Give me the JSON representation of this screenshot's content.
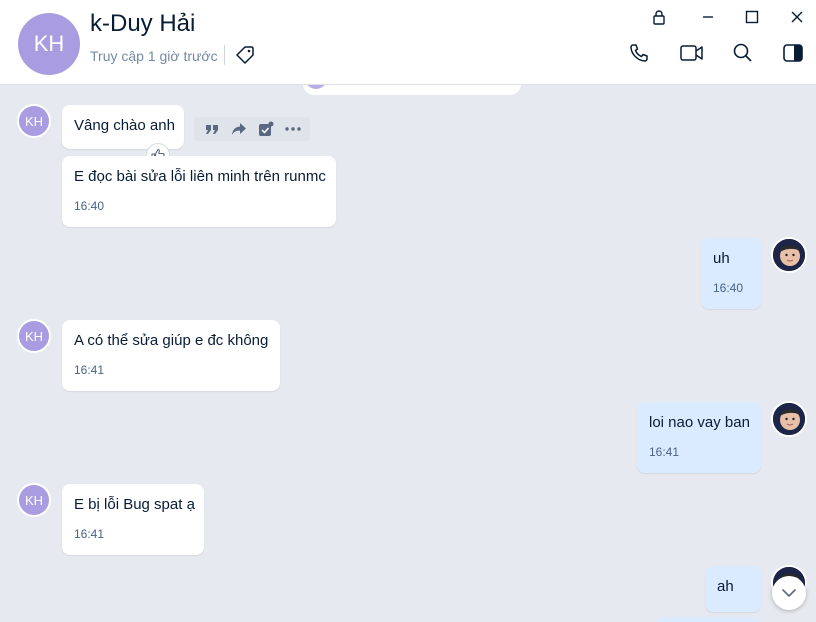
{
  "header": {
    "avatar_initials": "KH",
    "contact_name": "k-Duy Hải",
    "last_seen": "Truy cập 1 giờ trước"
  },
  "colors": {
    "avatar": "#a99ce0",
    "my_bubble": "#dbebff",
    "their_bubble": "#ffffff",
    "chat_bg": "#e6e9ef"
  },
  "icons": [
    "lock-icon",
    "minimize-icon",
    "maximize-icon",
    "close-icon",
    "tag-icon",
    "phone-icon",
    "video-icon",
    "search-icon",
    "sidebar-toggle-icon",
    "quote-icon",
    "forward-icon",
    "task-icon",
    "more-icon",
    "like-icon",
    "chevron-down-icon"
  ],
  "messages": [
    {
      "side": "them",
      "avatar": "KH",
      "text": "Vâng chào anh",
      "time": ""
    },
    {
      "side": "them",
      "avatar": "",
      "text": "E đọc bài sửa lỗi liên minh trên runmc",
      "time": "16:40"
    },
    {
      "side": "me",
      "text": "uh",
      "time": "16:40"
    },
    {
      "side": "them",
      "avatar": "KH",
      "text": "A có thể sửa giúp e đc không",
      "time": "16:41"
    },
    {
      "side": "me",
      "text": "loi nao vay ban",
      "time": "16:41"
    },
    {
      "side": "them",
      "avatar": "KH",
      "text": "E bị lỗi Bug spat ạ",
      "time": "16:41"
    },
    {
      "side": "me",
      "text": "ah",
      "time": ""
    }
  ]
}
